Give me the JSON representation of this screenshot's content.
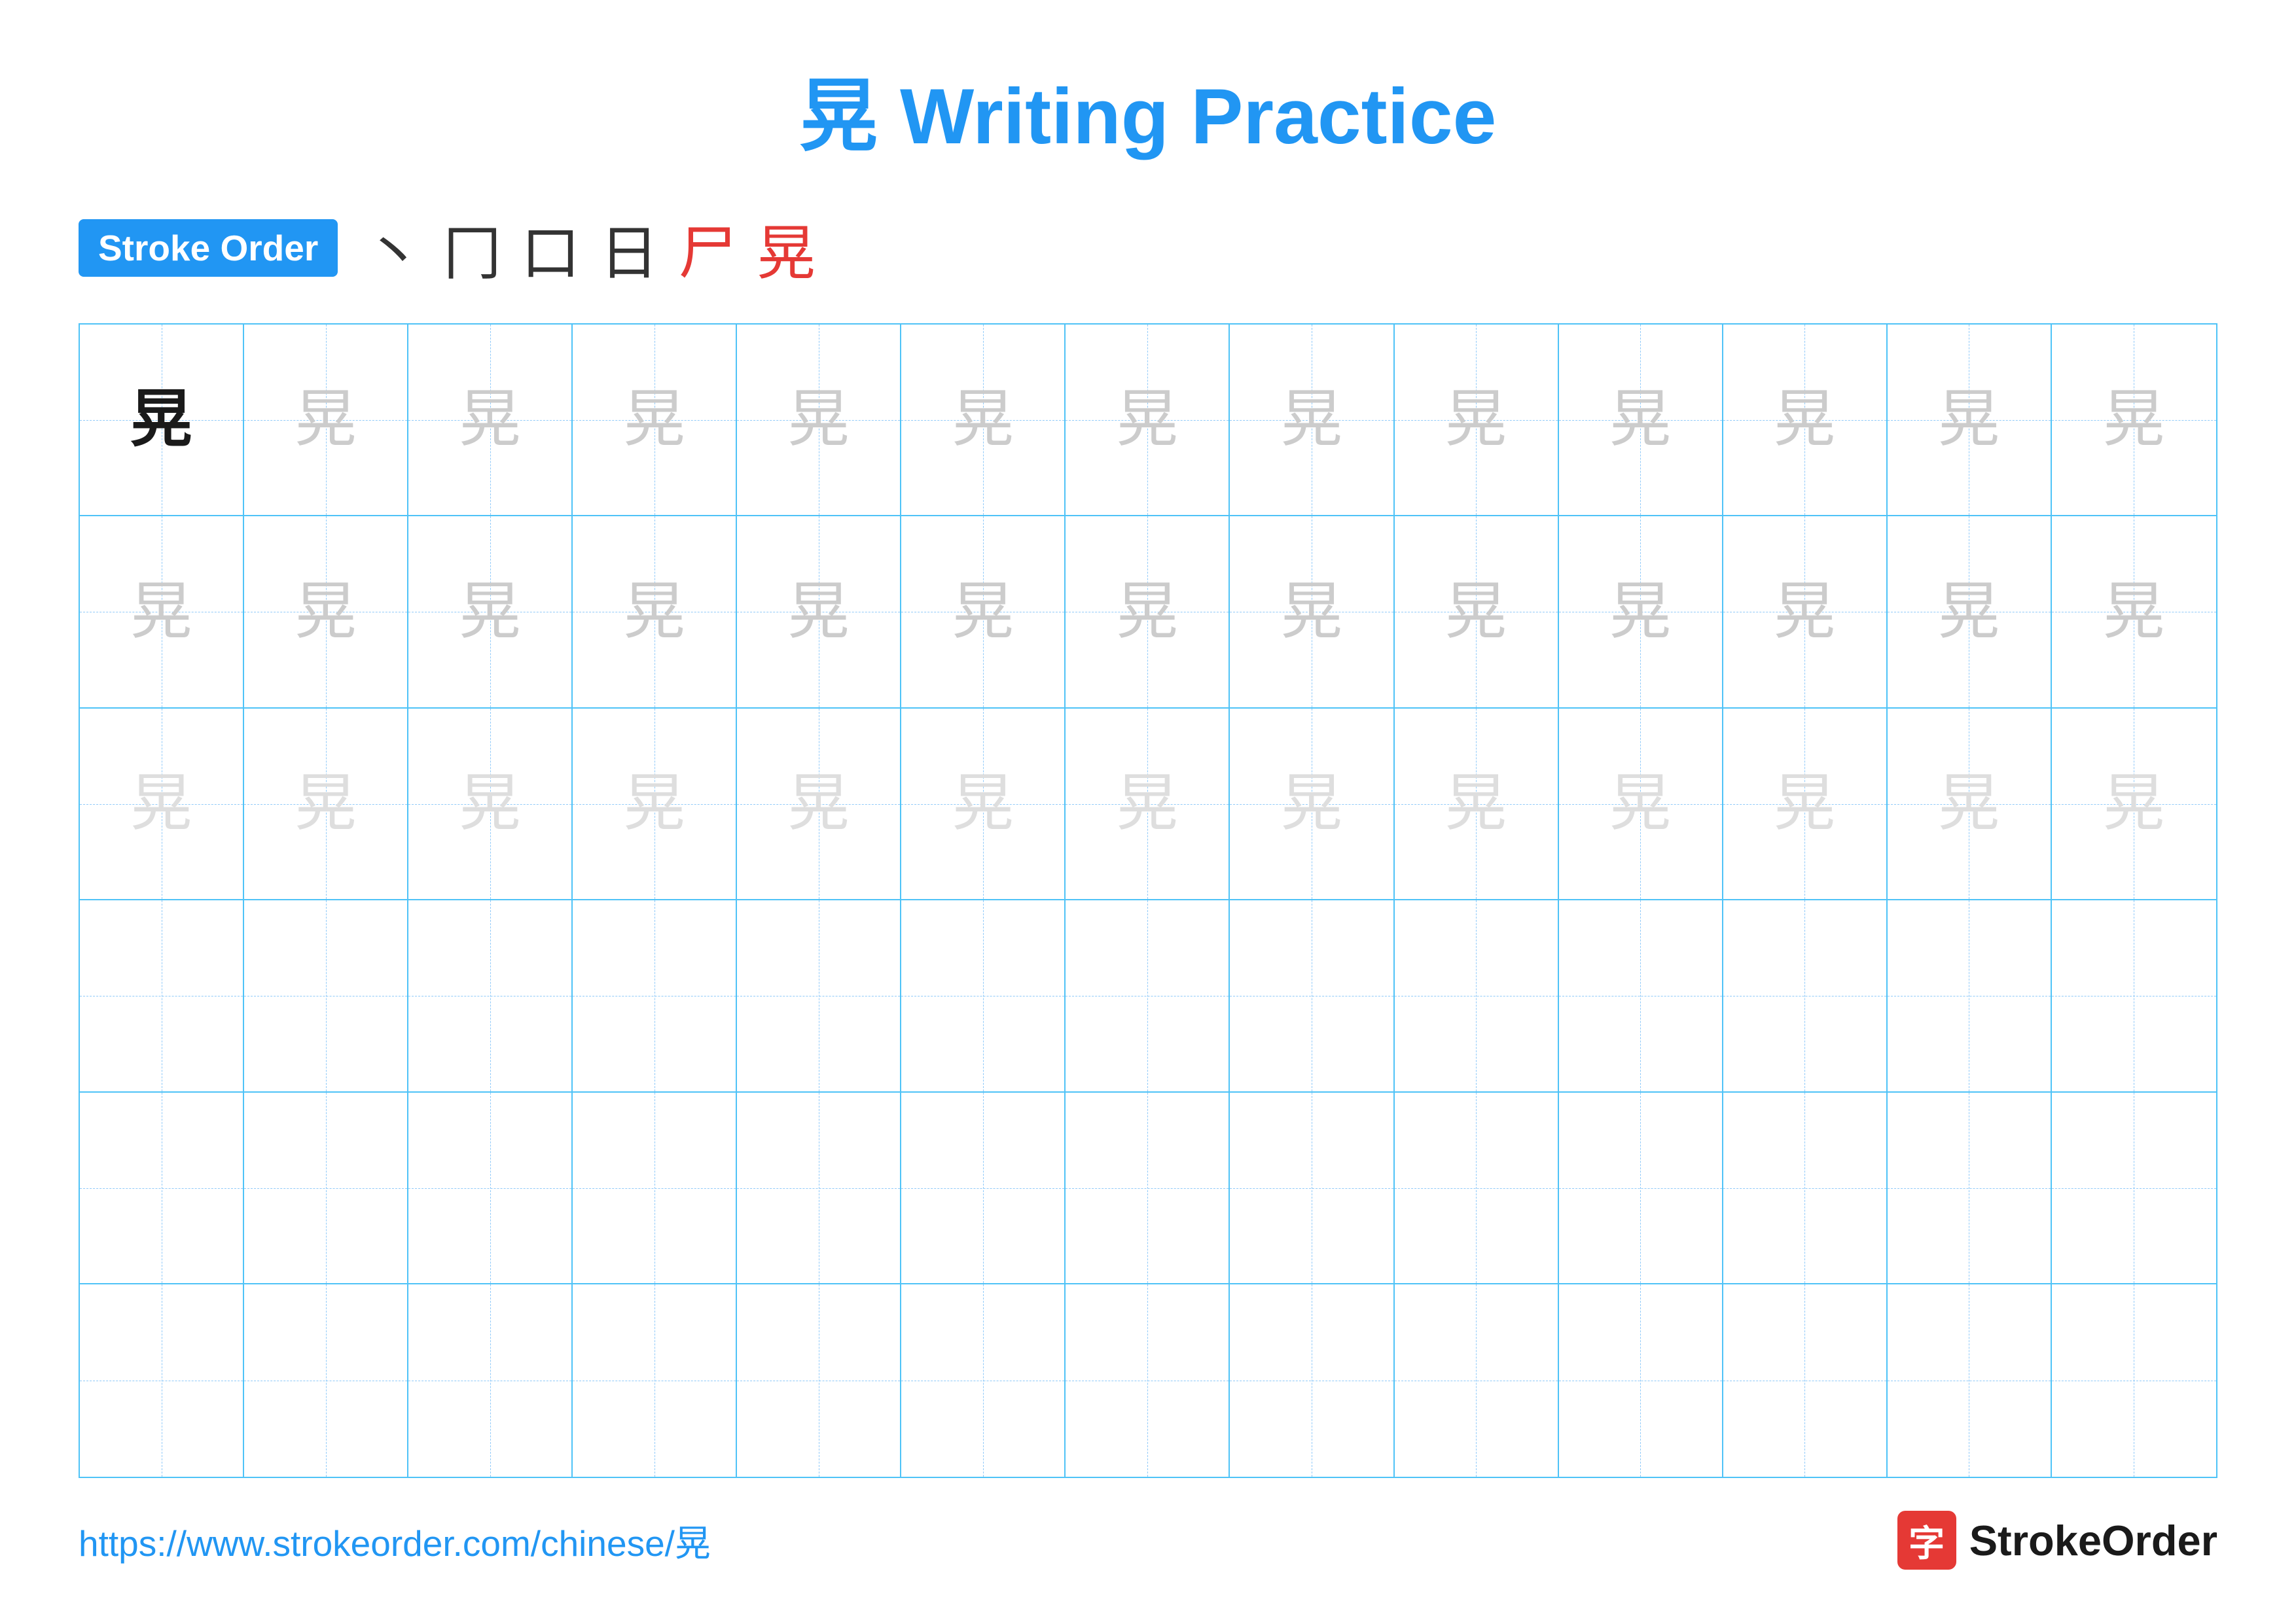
{
  "title": {
    "character": "晃",
    "label": " Writing Practice"
  },
  "stroke_order": {
    "badge_label": "Stroke Order",
    "strokes": [
      "丶",
      "冂",
      "口",
      "日",
      "尸",
      "晃"
    ]
  },
  "grid": {
    "rows": 6,
    "cols": 13,
    "row_data": [
      {
        "cells": [
          {
            "char": "晃",
            "style": "dark"
          },
          {
            "char": "晃",
            "style": "light"
          },
          {
            "char": "晃",
            "style": "light"
          },
          {
            "char": "晃",
            "style": "light"
          },
          {
            "char": "晃",
            "style": "light"
          },
          {
            "char": "晃",
            "style": "light"
          },
          {
            "char": "晃",
            "style": "light"
          },
          {
            "char": "晃",
            "style": "light"
          },
          {
            "char": "晃",
            "style": "light"
          },
          {
            "char": "晃",
            "style": "light"
          },
          {
            "char": "晃",
            "style": "light"
          },
          {
            "char": "晃",
            "style": "light"
          },
          {
            "char": "晃",
            "style": "light"
          }
        ]
      },
      {
        "cells": [
          {
            "char": "晃",
            "style": "light"
          },
          {
            "char": "晃",
            "style": "light"
          },
          {
            "char": "晃",
            "style": "light"
          },
          {
            "char": "晃",
            "style": "light"
          },
          {
            "char": "晃",
            "style": "light"
          },
          {
            "char": "晃",
            "style": "light"
          },
          {
            "char": "晃",
            "style": "light"
          },
          {
            "char": "晃",
            "style": "light"
          },
          {
            "char": "晃",
            "style": "light"
          },
          {
            "char": "晃",
            "style": "light"
          },
          {
            "char": "晃",
            "style": "light"
          },
          {
            "char": "晃",
            "style": "light"
          },
          {
            "char": "晃",
            "style": "light"
          }
        ]
      },
      {
        "cells": [
          {
            "char": "晃",
            "style": "lighter"
          },
          {
            "char": "晃",
            "style": "lighter"
          },
          {
            "char": "晃",
            "style": "lighter"
          },
          {
            "char": "晃",
            "style": "lighter"
          },
          {
            "char": "晃",
            "style": "lighter"
          },
          {
            "char": "晃",
            "style": "lighter"
          },
          {
            "char": "晃",
            "style": "lighter"
          },
          {
            "char": "晃",
            "style": "lighter"
          },
          {
            "char": "晃",
            "style": "lighter"
          },
          {
            "char": "晃",
            "style": "lighter"
          },
          {
            "char": "晃",
            "style": "lighter"
          },
          {
            "char": "晃",
            "style": "lighter"
          },
          {
            "char": "晃",
            "style": "lighter"
          }
        ]
      },
      {
        "cells": [
          {
            "char": "",
            "style": "empty"
          },
          {
            "char": "",
            "style": "empty"
          },
          {
            "char": "",
            "style": "empty"
          },
          {
            "char": "",
            "style": "empty"
          },
          {
            "char": "",
            "style": "empty"
          },
          {
            "char": "",
            "style": "empty"
          },
          {
            "char": "",
            "style": "empty"
          },
          {
            "char": "",
            "style": "empty"
          },
          {
            "char": "",
            "style": "empty"
          },
          {
            "char": "",
            "style": "empty"
          },
          {
            "char": "",
            "style": "empty"
          },
          {
            "char": "",
            "style": "empty"
          },
          {
            "char": "",
            "style": "empty"
          }
        ]
      },
      {
        "cells": [
          {
            "char": "",
            "style": "empty"
          },
          {
            "char": "",
            "style": "empty"
          },
          {
            "char": "",
            "style": "empty"
          },
          {
            "char": "",
            "style": "empty"
          },
          {
            "char": "",
            "style": "empty"
          },
          {
            "char": "",
            "style": "empty"
          },
          {
            "char": "",
            "style": "empty"
          },
          {
            "char": "",
            "style": "empty"
          },
          {
            "char": "",
            "style": "empty"
          },
          {
            "char": "",
            "style": "empty"
          },
          {
            "char": "",
            "style": "empty"
          },
          {
            "char": "",
            "style": "empty"
          },
          {
            "char": "",
            "style": "empty"
          }
        ]
      },
      {
        "cells": [
          {
            "char": "",
            "style": "empty"
          },
          {
            "char": "",
            "style": "empty"
          },
          {
            "char": "",
            "style": "empty"
          },
          {
            "char": "",
            "style": "empty"
          },
          {
            "char": "",
            "style": "empty"
          },
          {
            "char": "",
            "style": "empty"
          },
          {
            "char": "",
            "style": "empty"
          },
          {
            "char": "",
            "style": "empty"
          },
          {
            "char": "",
            "style": "empty"
          },
          {
            "char": "",
            "style": "empty"
          },
          {
            "char": "",
            "style": "empty"
          },
          {
            "char": "",
            "style": "empty"
          },
          {
            "char": "",
            "style": "empty"
          }
        ]
      }
    ]
  },
  "footer": {
    "url": "https://www.strokeorder.com/chinese/晃",
    "logo_char": "字",
    "logo_text": "StrokeOrder"
  },
  "colors": {
    "blue_accent": "#2196F3",
    "red_accent": "#e53935",
    "grid_border": "#4FC3F7",
    "grid_dashed": "#90CAF9",
    "char_dark": "#1a1a1a",
    "char_light": "#cccccc",
    "char_lighter": "#dedede"
  }
}
